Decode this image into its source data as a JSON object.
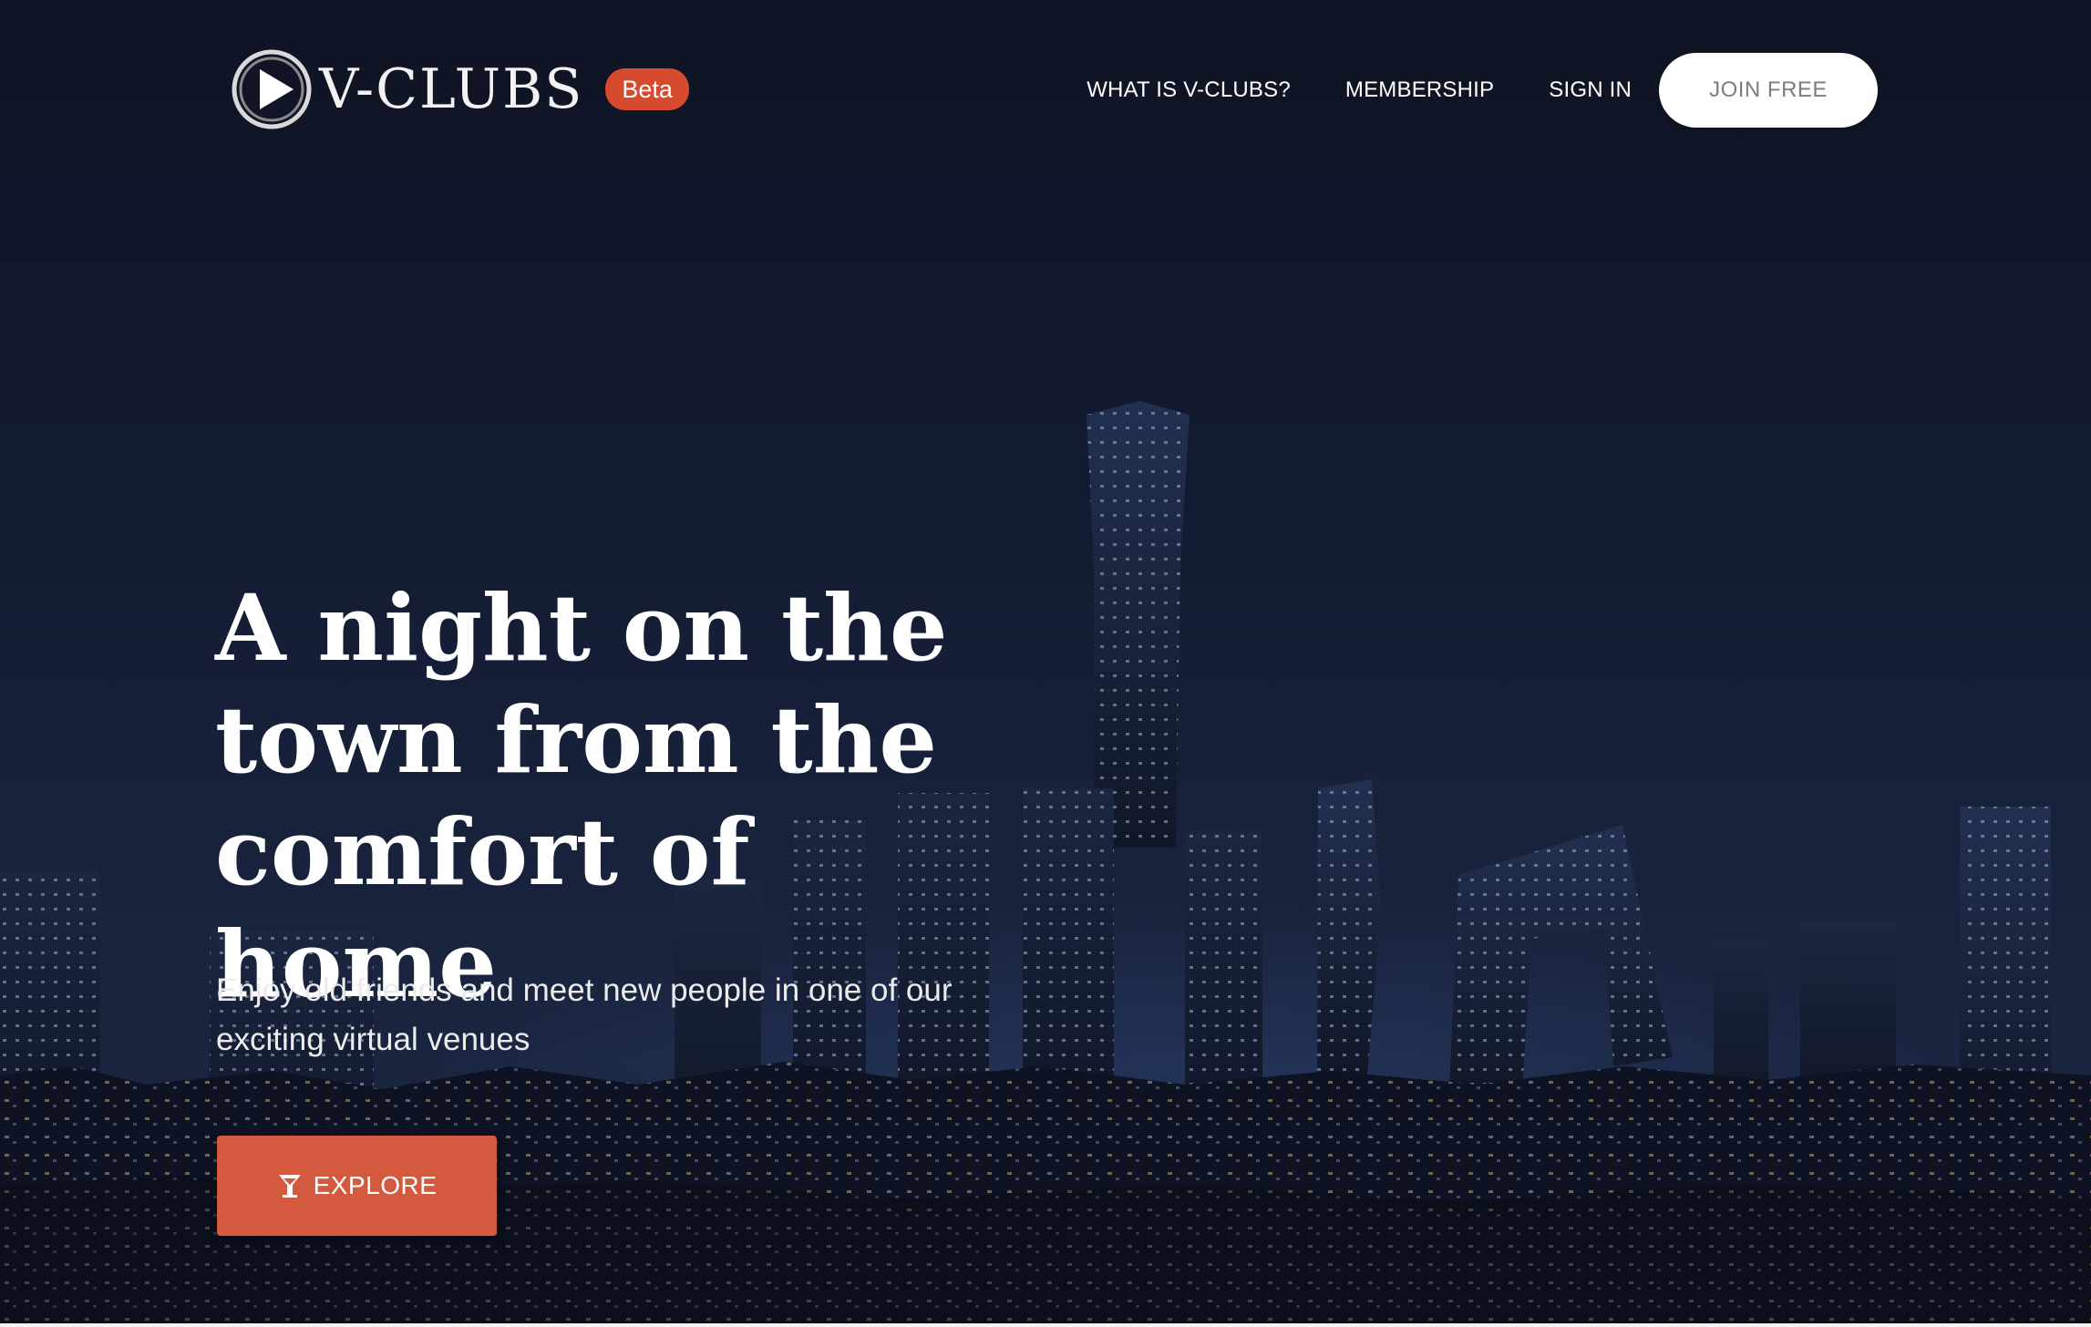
{
  "brand": {
    "name": "V-CLUBS",
    "badge": "Beta",
    "logo_icon": "play-circle-icon"
  },
  "nav": {
    "items": [
      {
        "label": "WHAT IS V-CLUBS?"
      },
      {
        "label": "MEMBERSHIP"
      },
      {
        "label": "SIGN IN"
      }
    ],
    "cta_label": "JOIN FREE"
  },
  "hero": {
    "title": "A night on the town from the comfort of home",
    "subtitle": "Enjoy old friends and meet new people in one of our exciting virtual venues",
    "button_label": "EXPLORE",
    "button_icon": "cocktail-glass-icon"
  },
  "colors": {
    "accent": "#d45a3f",
    "badge": "#d64a2e",
    "background": "#131a2e"
  }
}
